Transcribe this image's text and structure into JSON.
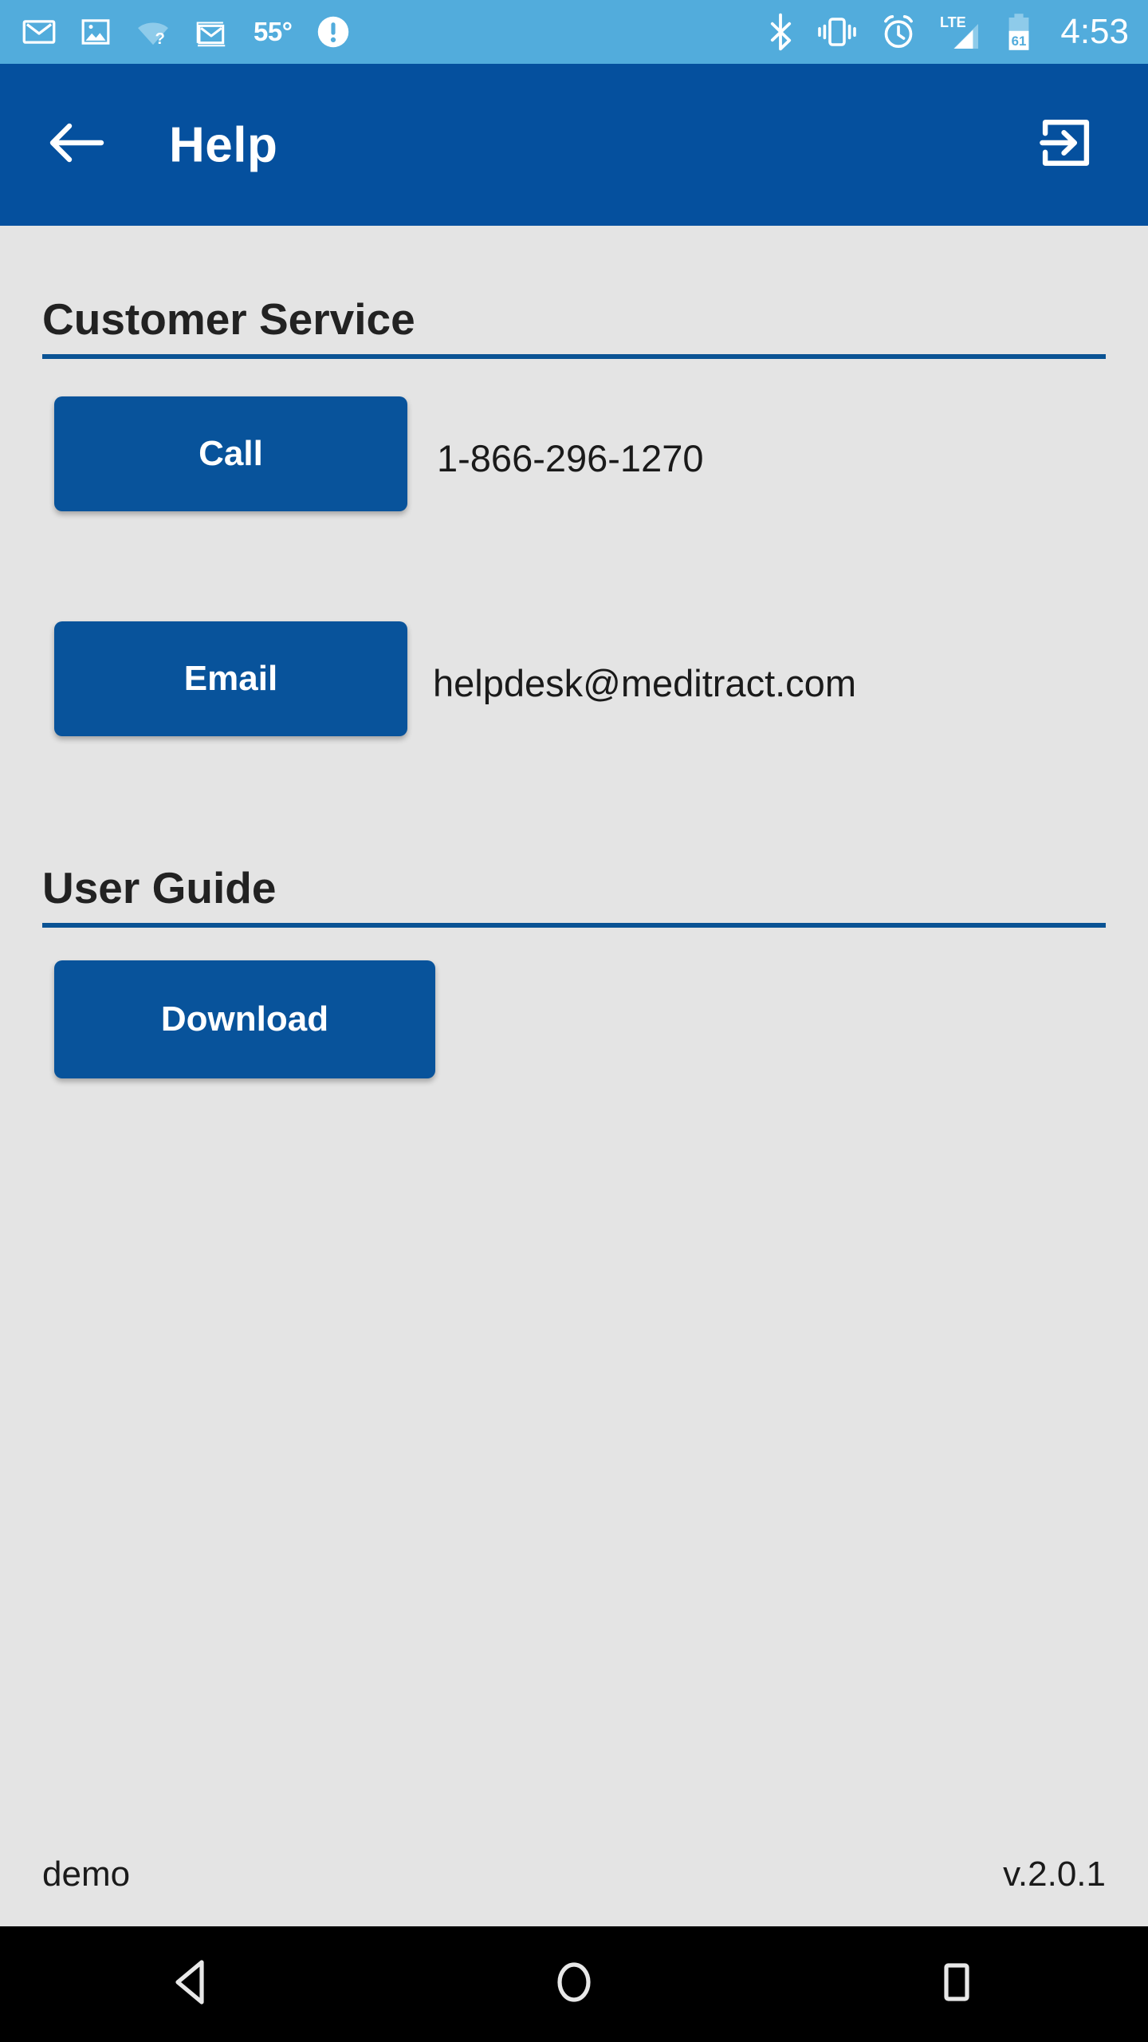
{
  "status_bar": {
    "background_color": "#52ACDC",
    "left_icons": [
      {
        "name": "gmail-icon",
        "label": "Gmail"
      },
      {
        "name": "photo-icon",
        "label": "Photos"
      },
      {
        "name": "wifi-question-icon",
        "label": "WiFi no internet"
      },
      {
        "name": "gmail-stack-icon",
        "label": "Gmail multiple"
      }
    ],
    "temperature": "55°",
    "warning_icon": "exclamation-circle-icon",
    "right_icons": [
      {
        "name": "bluetooth-icon",
        "label": "Bluetooth"
      },
      {
        "name": "vibrate-icon",
        "label": "Vibrate"
      },
      {
        "name": "alarm-icon",
        "label": "Alarm"
      },
      {
        "name": "signal-icon",
        "label": "LTE signal"
      }
    ],
    "network_type": "LTE",
    "battery_level": "61",
    "clock": "4:53"
  },
  "app_bar": {
    "background_color": "#05509E",
    "title": "Help",
    "back_icon": "arrow-left-icon",
    "logout_icon": "logout-icon"
  },
  "main": {
    "background_color": "#E4E4E4",
    "accent_color": "#0A5394",
    "button_color": "#08539B",
    "sections": [
      {
        "heading": "Customer Service",
        "rows": [
          {
            "button_label": "Call",
            "value": "1-866-296-1270"
          },
          {
            "button_label": "Email",
            "value": "helpdesk@meditract.com"
          }
        ]
      },
      {
        "heading": "User Guide",
        "rows": [
          {
            "button_label": "Download",
            "value": ""
          }
        ]
      }
    ]
  },
  "footer": {
    "environment": "demo",
    "version": "v.2.0.1"
  },
  "nav_bar": {
    "background_color": "#000000",
    "buttons": [
      {
        "name": "nav-back",
        "icon": "triangle-back-icon"
      },
      {
        "name": "nav-home",
        "icon": "circle-home-icon"
      },
      {
        "name": "nav-recents",
        "icon": "square-recents-icon"
      }
    ]
  }
}
